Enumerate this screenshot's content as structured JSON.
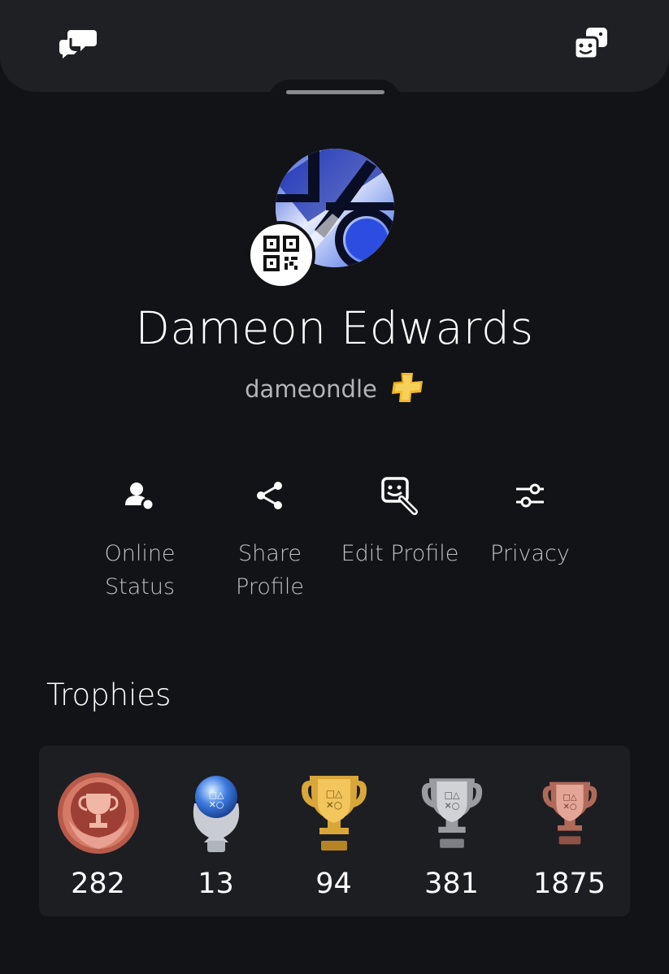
{
  "header": {
    "left_icon": "chat-bubbles-icon",
    "right_icon": "game-faces-icon"
  },
  "profile": {
    "display_name": "Dameon Edwards",
    "online_id": "dameondle",
    "plus_icon": "ps-plus-icon",
    "qr_icon": "qr-code-icon"
  },
  "actions": [
    {
      "label": "Online\nStatus",
      "icon": "user-status-icon"
    },
    {
      "label": "Share\nProfile",
      "icon": "share-icon"
    },
    {
      "label": "Edit Profile",
      "icon": "edit-profile-icon"
    },
    {
      "label": "Privacy",
      "icon": "sliders-icon"
    }
  ],
  "trophies": {
    "title": "Trophies",
    "items": [
      {
        "type": "level",
        "count": "282",
        "color": "#c0675a"
      },
      {
        "type": "platinum",
        "count": "13",
        "color": "#5c8ad8"
      },
      {
        "type": "gold",
        "count": "94",
        "color": "#d4a236"
      },
      {
        "type": "silver",
        "count": "381",
        "color": "#a9abb0"
      },
      {
        "type": "bronze",
        "count": "1875",
        "color": "#c07a6a"
      }
    ]
  },
  "colors": {
    "background": "#121316",
    "card": "#1d1e22",
    "header": "#1f2024",
    "plus_gold": "#f0b92b"
  }
}
